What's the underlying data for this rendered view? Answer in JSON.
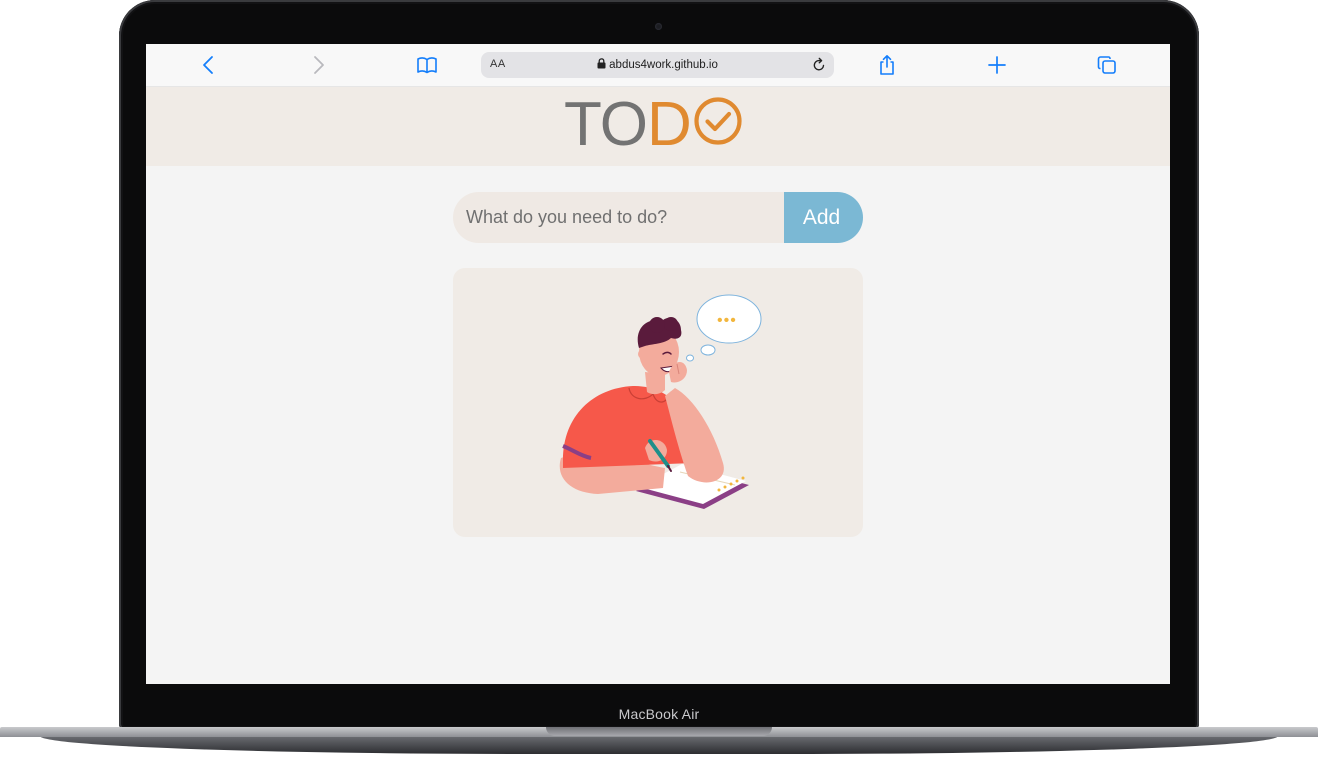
{
  "device": {
    "label": "MacBook Air"
  },
  "browser": {
    "text_size_label": "AA",
    "url": "abdus4work.github.io",
    "icons": [
      "back-icon",
      "forward-icon",
      "bookmarks-icon",
      "lock-icon",
      "reload-icon",
      "share-icon",
      "new-tab-icon",
      "tabs-icon"
    ],
    "accent_color": "#147efb"
  },
  "app": {
    "logo": {
      "part1": "TO",
      "part2": "D"
    },
    "input": {
      "placeholder": "What do you need to do?",
      "value": ""
    },
    "add_button_label": "Add",
    "empty_state": {
      "illustration": "person-thinking-writing",
      "thought_bubble": "•••"
    },
    "colors": {
      "header_bg": "#f0ebe6",
      "accent_orange": "#e08a30",
      "logo_gray": "#737373",
      "button_blue": "#7bb8d4",
      "page_bg": "#f4f4f4"
    }
  }
}
